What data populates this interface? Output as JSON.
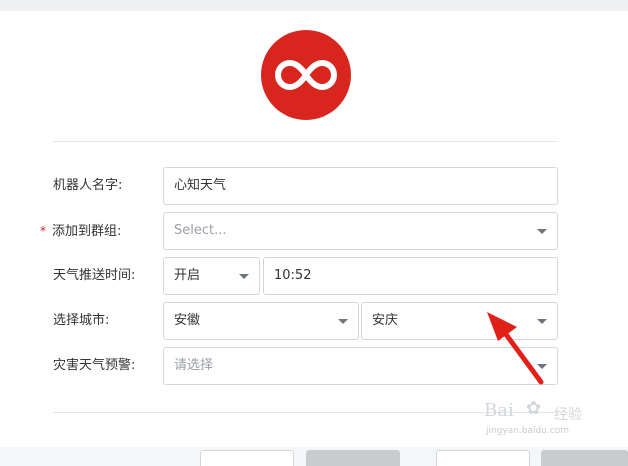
{
  "form": {
    "robot_name": {
      "label": "机器人名字:",
      "value": "心知天气"
    },
    "add_to_group": {
      "required_mark": "*",
      "label": "添加到群组:",
      "placeholder": "Select..."
    },
    "push_time": {
      "label": "天气推送时间:",
      "switch_value": "开启",
      "time_value": "10:52"
    },
    "city": {
      "label": "选择城市:",
      "province": "安徽",
      "city": "安庆"
    },
    "disaster_alert": {
      "label": "灾害天气预警:",
      "placeholder": "请选择"
    }
  },
  "watermark": {
    "brand": "Bai",
    "brand_cn": "经验",
    "url": "jingyan.baidu.com"
  },
  "colors": {
    "accent": "#d8261f",
    "border": "#d3d6db",
    "placeholder": "#9a9ea5"
  },
  "icons": {
    "logo": "infinity-logo-icon",
    "dropdown": "chevron-down-icon",
    "annotation": "red-arrow-annotation"
  }
}
